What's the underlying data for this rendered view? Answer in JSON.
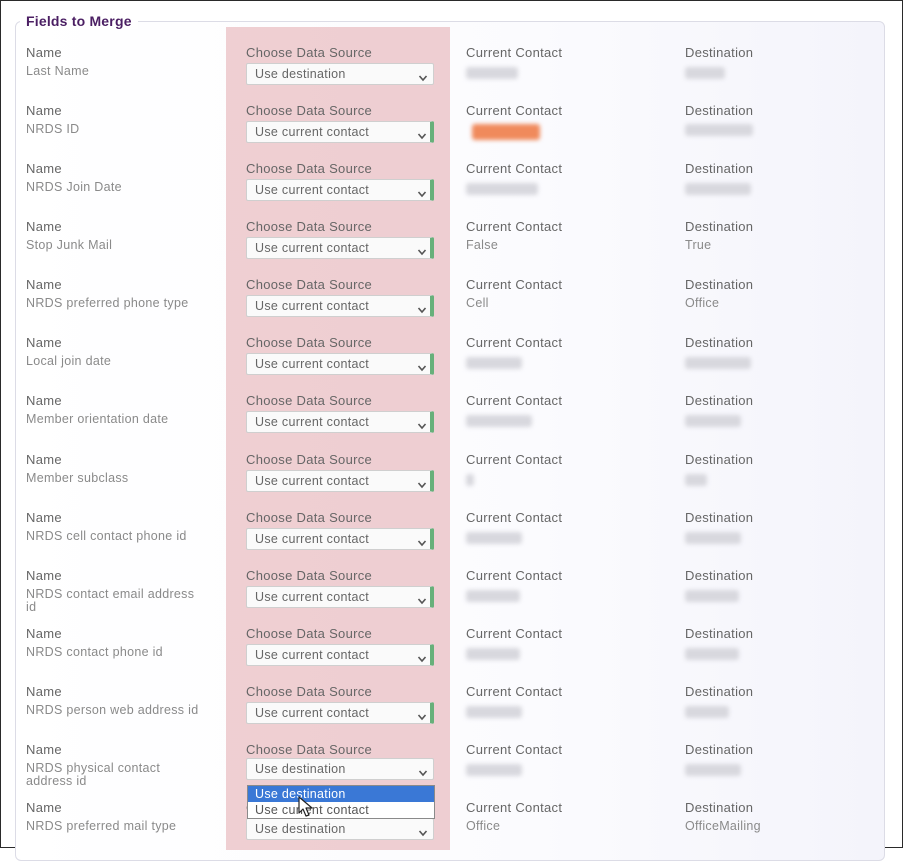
{
  "section": {
    "title": "Fields to Merge"
  },
  "column_labels": {
    "name": "Name",
    "source": "Choose Data Source",
    "current": "Current Contact",
    "destination": "Destination"
  },
  "rows": [
    {
      "name": "Last Name",
      "source": "Use destination",
      "current": "",
      "destination": ""
    },
    {
      "name": "NRDS ID",
      "source": "Use current contact",
      "current": "",
      "destination": ""
    },
    {
      "name": "NRDS Join Date",
      "source": "Use current contact",
      "current": "",
      "destination": ""
    },
    {
      "name": "Stop Junk Mail",
      "source": "Use current contact",
      "current": "False",
      "destination": "True"
    },
    {
      "name": "NRDS preferred phone type",
      "source": "Use current contact",
      "current": "Cell",
      "destination": "Office"
    },
    {
      "name": "Local join date",
      "source": "Use current contact",
      "current": "",
      "destination": ""
    },
    {
      "name": "Member orientation date",
      "source": "Use current contact",
      "current": "",
      "destination": ""
    },
    {
      "name": "Member subclass",
      "source": "Use current contact",
      "current": "",
      "destination": ""
    },
    {
      "name": "NRDS cell contact phone id",
      "source": "Use current contact",
      "current": "",
      "destination": ""
    },
    {
      "name": "NRDS contact email address id",
      "source": "Use current contact",
      "current": "",
      "destination": ""
    },
    {
      "name": "NRDS contact phone id",
      "source": "Use current contact",
      "current": "",
      "destination": ""
    },
    {
      "name": "NRDS person web address id",
      "source": "Use current contact",
      "current": "",
      "destination": ""
    },
    {
      "name": "NRDS physical contact address id",
      "source": "Use destination",
      "current": "",
      "destination": ""
    },
    {
      "name": "NRDS preferred mail type",
      "source": "Use destination",
      "current": "Office",
      "destination": "OfficeMailing"
    }
  ],
  "dropdown": {
    "options": [
      "Use destination",
      "Use current contact"
    ],
    "highlighted": "Use destination"
  },
  "colors": {
    "accent": "#4b1f63",
    "highlight": "#de969e",
    "selected_option": "#3a78d6",
    "flag": "#67b07a"
  }
}
